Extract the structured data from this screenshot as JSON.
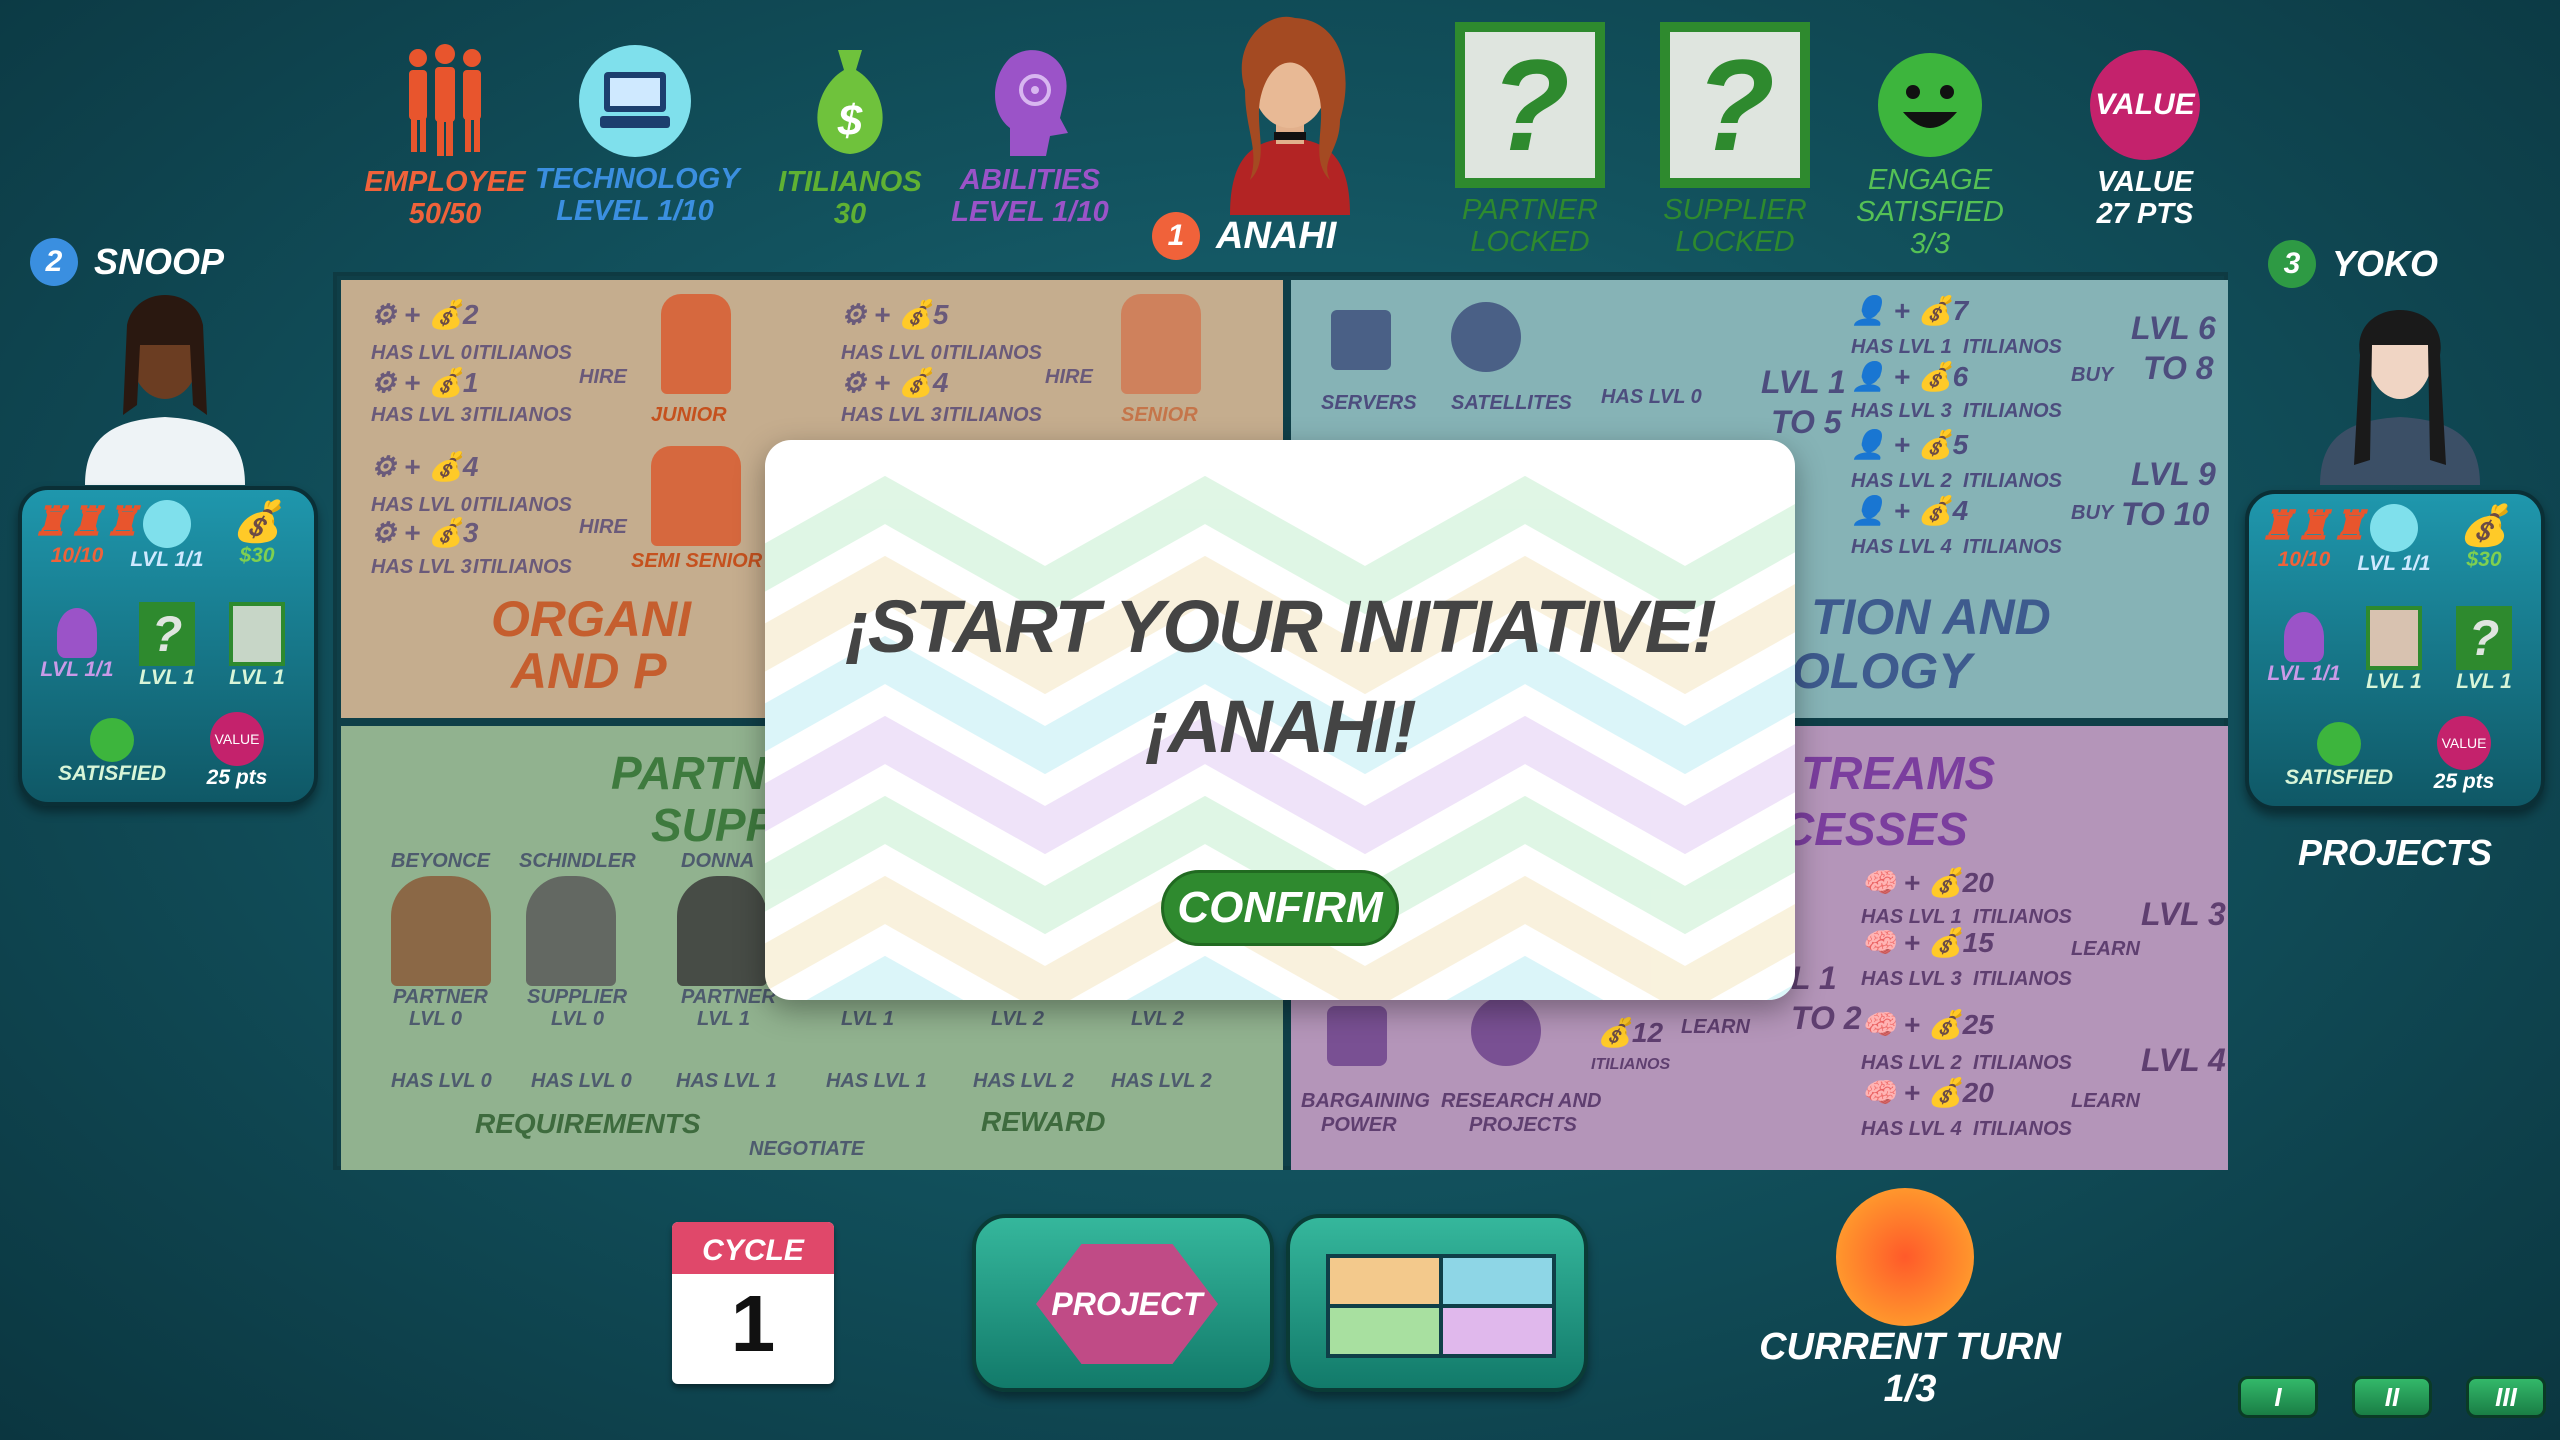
{
  "top_bar": {
    "employee": {
      "label": "EMPLOYEE",
      "value": "50/50",
      "color": "#f0623a"
    },
    "technology": {
      "label": "TECHNOLOGY",
      "value": "LEVEL  1/10",
      "color": "#3b8fe0"
    },
    "itilianos": {
      "label": "ITILIANOS",
      "value": "30",
      "color": "#5fb133"
    },
    "abilities": {
      "label": "ABILITIES",
      "value": "LEVEL  1/10",
      "color": "#9b53c8"
    },
    "current_player": {
      "number": "1",
      "name": "ANAHI",
      "badge_color": "#f0623a"
    },
    "partner": {
      "glyph": "?",
      "label": "PARTNER",
      "status": "LOCKED",
      "color": "#2e8a2e"
    },
    "supplier": {
      "glyph": "?",
      "label": "SUPPLIER",
      "status": "LOCKED",
      "color": "#2e8a2e"
    },
    "engage": {
      "label": "ENGAGE",
      "label2": "SATISFIED",
      "value": "3/3",
      "color": "#55c155"
    },
    "value": {
      "badge": "VALUE",
      "label": "VALUE",
      "value": "27 PTS",
      "color": "#c4226c"
    }
  },
  "players": {
    "left": {
      "number": "2",
      "name": "SNOOP",
      "badge_color": "#3a8fe0",
      "employee": "10/10",
      "technology": "LVL 1/1",
      "money": "$30",
      "abilities": "LVL 1/1",
      "partner": "LVL 1",
      "supplier": "LVL 1",
      "satisfied": "SATISFIED",
      "value_badge": "VALUE",
      "value_pts": "25 pts"
    },
    "right": {
      "number": "3",
      "name": "YOKO",
      "badge_color": "#2e9a44",
      "employee": "10/10",
      "technology": "LVL 1/1",
      "money": "$30",
      "abilities": "LVL 1/1",
      "partner": "LVL 1",
      "supplier": "LVL 1",
      "satisfied": "SATISFIED",
      "value_badge": "VALUE",
      "value_pts": "25 pts",
      "projects_label": "PROJECTS"
    }
  },
  "board": {
    "q1": {
      "title1": "ORGANI",
      "title2": "AND P",
      "hire": "HIRE",
      "has_lvl0": "HAS LVL 0",
      "has_lvl3": "HAS LVL 3",
      "itilianos": "ITILIANOS",
      "junior": "JUNIOR",
      "senior": "SENIOR",
      "semi_senior": "SEMI SENIOR",
      "n2": "2",
      "n1": "1",
      "n5": "5",
      "n4": "4",
      "n4b": "4",
      "n3": "3"
    },
    "q2": {
      "title1": "TION AND",
      "title2": "OLOGY",
      "servers": "SERVERS",
      "satellites": "SATELLITES",
      "has_lvl0": "HAS LVL 0",
      "buy": "BUY",
      "lvl1_5a": "LVL 1",
      "lvl1_5b": "TO 5",
      "lvl6_8a": "LVL 6",
      "lvl6_8b": "TO 8",
      "lvl9_10a": "LVL 9",
      "lvl9_10b": "TO 10",
      "has_lvl1": "HAS LVL 1",
      "has_lvl3": "HAS LVL 3",
      "has_lvl2": "HAS LVL 2",
      "has_lvl4": "HAS LVL 4",
      "itilianos": "ITILIANOS",
      "n7": "7",
      "n6": "6",
      "n5": "5",
      "n4": "4"
    },
    "q3": {
      "title1": "PARTN",
      "title2": "SUPP",
      "beyonce": "BEYONCE",
      "schindler": "SCHINDLER",
      "donna": "DONNA",
      "partner_lvl0": "PARTNER",
      "lvl0": "LVL 0",
      "supplier_lvl0": "SUPPLIER",
      "partner_lvl1": "PARTNER",
      "lvl1": "LVL 1",
      "has_lvl0": "HAS LVL 0",
      "has_lvl1": "HAS LVL 1",
      "has_lvl2": "HAS LVL 2",
      "lvl2": "LVL 2",
      "requirements": "REQUIREMENTS",
      "negotiate": "NEGOTIATE",
      "reward": "REWARD"
    },
    "q4": {
      "title1": "TREAMS",
      "title2": "CESSES",
      "has_lvl1": "HAS LVL 1",
      "has_lvl3": "HAS LVL 3",
      "has_lvl2": "HAS LVL 2",
      "has_lvl4": "HAS LVL 4",
      "itilianos": "ITILIANOS",
      "learn": "LEARN",
      "n20": "20",
      "n15": "15",
      "n25": "25",
      "n20b": "20",
      "n12": "12",
      "lvl3": "LVL 3",
      "lvl4": "LVL 4",
      "lvl1": "L 1",
      "to2": "TO 2",
      "bargaining": "BARGAINING",
      "power": "POWER",
      "research": "RESEARCH AND",
      "projects": "PROJECTS"
    }
  },
  "modal": {
    "title": "¡START YOUR INITIATIVE!",
    "subtitle": "¡ANAHI!",
    "confirm": "CONFIRM"
  },
  "bottom": {
    "cycle_label": "CYCLE",
    "cycle_value": "1",
    "project_button": "PROJECT",
    "current_turn_label": "CURRENT TURN",
    "current_turn_value": "1/3",
    "pages": [
      "I",
      "II",
      "III"
    ]
  }
}
